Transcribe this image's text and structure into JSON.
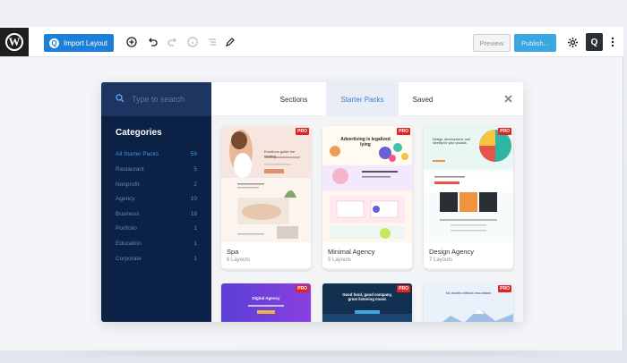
{
  "toolbar": {
    "import_label": "Import Layout",
    "preview_label": "Preview",
    "publish_label": "Publish...",
    "q_label": "Q",
    "icons": [
      "add-block-icon",
      "undo-icon",
      "redo-icon",
      "info-icon",
      "list-view-icon",
      "edit-icon",
      "gear-icon",
      "more-vertical-icon"
    ]
  },
  "modal": {
    "search_placeholder": "Type to search",
    "categories_title": "Categories",
    "categories": [
      {
        "name": "All Starter Packs",
        "count": "58"
      },
      {
        "name": "Restaurant",
        "count": "5"
      },
      {
        "name": "Nonprofit",
        "count": "2"
      },
      {
        "name": "Agency",
        "count": "10"
      },
      {
        "name": "Business",
        "count": "18"
      },
      {
        "name": "Portfolio",
        "count": "1"
      },
      {
        "name": "Education",
        "count": "1"
      },
      {
        "name": "Corporate",
        "count": "1"
      }
    ],
    "tabs": [
      "Sections",
      "Starter Packs",
      "Saved"
    ],
    "active_tab": "Starter Packs",
    "close_icon": "close-icon",
    "cards": [
      {
        "name": "Spa",
        "count": "6 Layouts",
        "badge": "PRO",
        "thumb_text": "Emotions guide the healing"
      },
      {
        "name": "Minimal Agency",
        "count": "5 Layouts",
        "badge": "PRO",
        "thumb_text": "Advertising is legalized lying"
      },
      {
        "name": "Design Agency",
        "count": "7 Layouts",
        "badge": "PRO",
        "thumb_text": "Design, development, and identity for your product."
      },
      {
        "name": "",
        "count": "",
        "badge": "PRO",
        "thumb_text": "Digital Agency"
      },
      {
        "name": "",
        "count": "",
        "badge": "PRO",
        "thumb_text": "Good food, good company, great listening music"
      },
      {
        "name": "",
        "count": "",
        "badge": "PRO",
        "thumb_text": "No health without mountains"
      }
    ]
  },
  "colors": {
    "accent": "#1e7fd8",
    "sidebar_bg": "#0b2145",
    "pro_badge": "#e02424"
  }
}
